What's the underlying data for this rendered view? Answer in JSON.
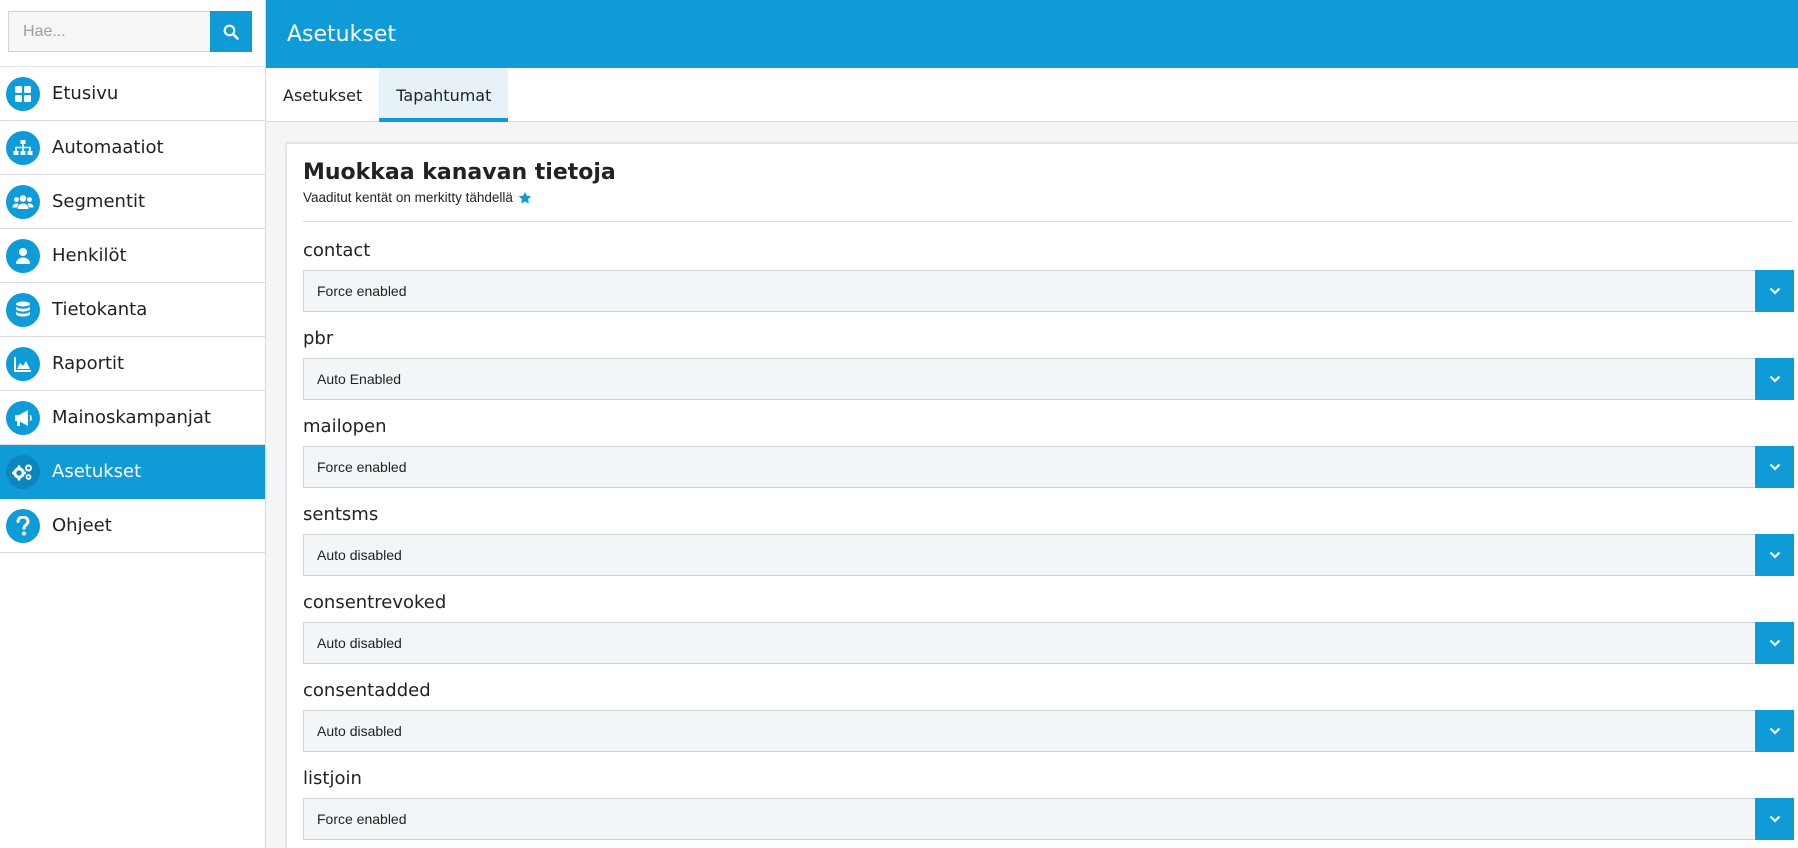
{
  "search": {
    "placeholder": "Hae..."
  },
  "sidebar": {
    "items": [
      {
        "label": "Etusivu",
        "icon": "dashboard-icon"
      },
      {
        "label": "Automaatiot",
        "icon": "sitemap-icon"
      },
      {
        "label": "Segmentit",
        "icon": "users-icon"
      },
      {
        "label": "Henkilöt",
        "icon": "user-icon"
      },
      {
        "label": "Tietokanta",
        "icon": "database-icon"
      },
      {
        "label": "Raportit",
        "icon": "area-chart-icon"
      },
      {
        "label": "Mainoskampanjat",
        "icon": "megaphone-icon"
      },
      {
        "label": "Asetukset",
        "icon": "cogs-icon",
        "active": true
      },
      {
        "label": "Ohjeet",
        "icon": "question-icon"
      }
    ]
  },
  "header": {
    "title": "Asetukset"
  },
  "tabs": [
    {
      "label": "Asetukset",
      "active": false
    },
    {
      "label": "Tapahtumat",
      "active": true
    }
  ],
  "form": {
    "title": "Muokkaa kanavan tietoja",
    "subtitle": "Vaaditut kentät on merkitty tähdellä",
    "fields": [
      {
        "label": "contact",
        "value": "Force enabled"
      },
      {
        "label": "pbr",
        "value": "Auto Enabled"
      },
      {
        "label": "mailopen",
        "value": "Force enabled"
      },
      {
        "label": "sentsms",
        "value": "Auto disabled"
      },
      {
        "label": "consentrevoked",
        "value": "Auto disabled"
      },
      {
        "label": "consentadded",
        "value": "Auto disabled"
      },
      {
        "label": "listjoin",
        "value": "Force enabled"
      }
    ]
  },
  "colors": {
    "accent": "#0f9bd7",
    "tab_active_bg": "#e6f1f8",
    "content_bg": "#f3f5f7"
  }
}
